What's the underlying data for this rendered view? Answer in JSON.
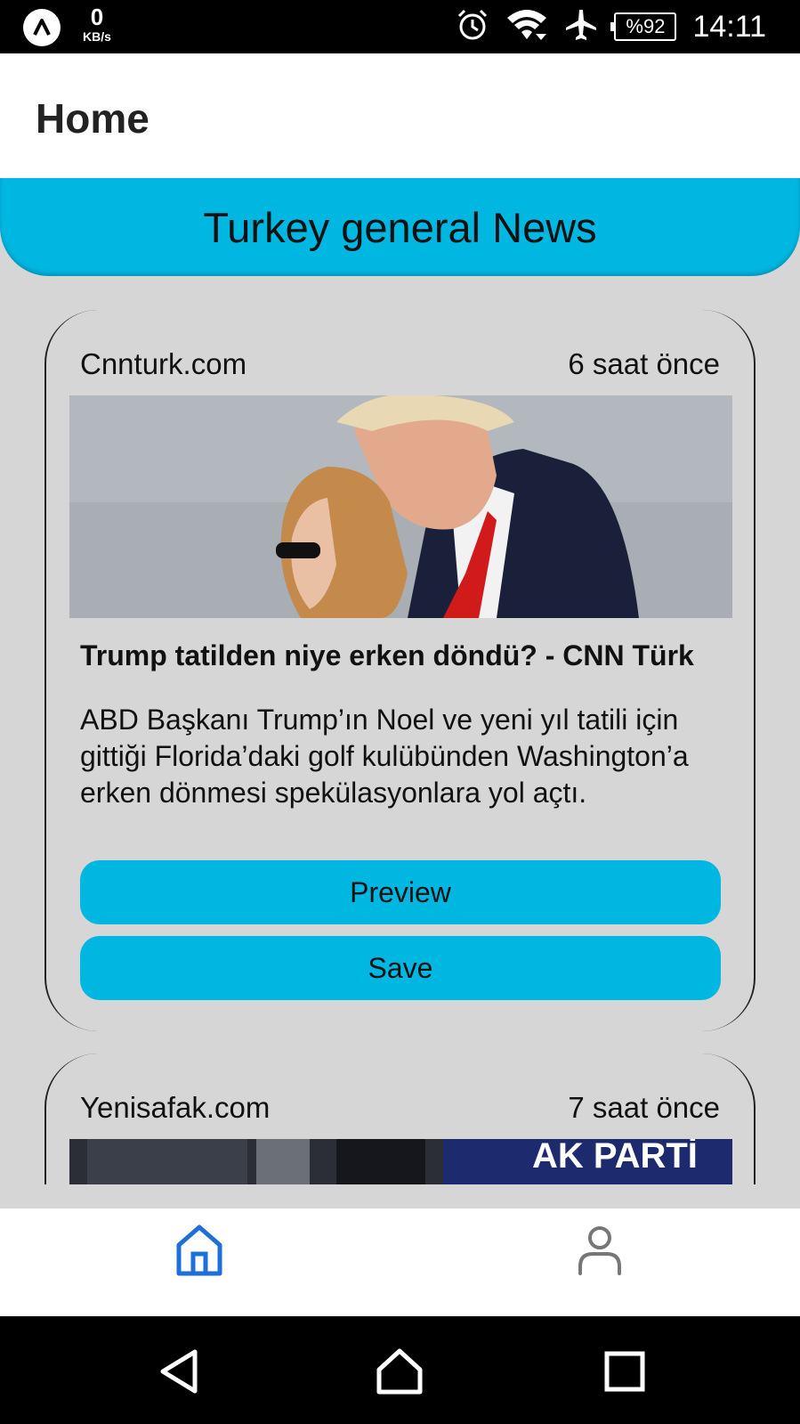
{
  "status_bar": {
    "net_speed_value": "0",
    "net_speed_unit": "KB/s",
    "battery": "%92",
    "clock": "14:11",
    "icons": [
      "app-badge-icon",
      "alarm-icon",
      "wifi-icon",
      "airplane-icon",
      "battery-icon"
    ]
  },
  "app_bar": {
    "title": "Home"
  },
  "banner": {
    "text": "Turkey general News"
  },
  "articles": [
    {
      "source": "Cnnturk.com",
      "time": "6 saat önce",
      "headline": "Trump tatilden niye erken döndü? - CNN Türk",
      "description": "ABD Başkanı Trump’ın Noel ve yeni yıl tatili için gittiği Florida’daki golf kulübünden Washington’a erken dönmesi spekülasyonlara yol açtı.",
      "preview_label": "Preview",
      "save_label": "Save"
    },
    {
      "source": "Yenisafak.com",
      "time": "7 saat önce",
      "image_text": "AK PARTİ"
    }
  ],
  "bottom_nav": {
    "items": [
      {
        "icon": "home-icon",
        "active": true
      },
      {
        "icon": "profile-icon",
        "active": false
      }
    ],
    "active_color": "#1e6fd9",
    "inactive_color": "#777777"
  },
  "colors": {
    "accent": "#00b7e1",
    "background": "#d6d6d6"
  }
}
